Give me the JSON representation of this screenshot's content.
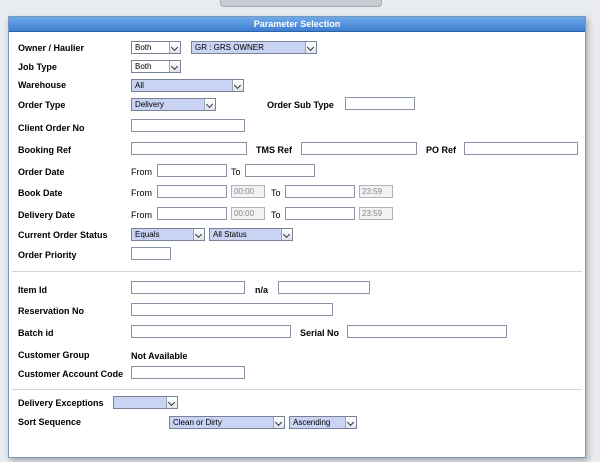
{
  "header": {
    "title": "Parameter Selection"
  },
  "owner_haulier": {
    "label": "Owner / Haulier",
    "scope": "Both",
    "owner": "GR : GRS OWNER"
  },
  "job_type": {
    "label": "Job Type",
    "value": "Both"
  },
  "warehouse": {
    "label": "Warehouse",
    "value": "All"
  },
  "order_type": {
    "label": "Order Type",
    "value": "Delivery",
    "sub_type_label": "Order Sub Type",
    "sub_type_value": ""
  },
  "client_order_no": {
    "label": "Client Order No",
    "value": ""
  },
  "booking_ref": {
    "label": "Booking Ref",
    "value": "",
    "tms_label": "TMS Ref",
    "tms_value": "",
    "po_label": "PO Ref",
    "po_value": ""
  },
  "order_date": {
    "label": "Order Date",
    "from_label": "From",
    "to_label": "To",
    "from_value": "",
    "to_value": ""
  },
  "book_date": {
    "label": "Book Date",
    "from_label": "From",
    "to_label": "To",
    "from_date": "",
    "from_time": "00:00",
    "to_date": "",
    "to_time": "23:59"
  },
  "delivery_date": {
    "label": "Delivery Date",
    "from_label": "From",
    "to_label": "To",
    "from_date": "",
    "from_time": "00:00",
    "to_date": "",
    "to_time": "23:59"
  },
  "current_order_status": {
    "label": "Current Order Status",
    "operator": "Equals",
    "status": "All Status"
  },
  "order_priority": {
    "label": "Order Priority",
    "value": ""
  },
  "item_id": {
    "label": "Item Id",
    "value": "",
    "na_label": "n/a",
    "na_value": ""
  },
  "reservation_no": {
    "label": "Reservation No",
    "value": ""
  },
  "batch_id": {
    "label": "Batch id",
    "value": "",
    "serial_label": "Serial No",
    "serial_value": ""
  },
  "customer_group": {
    "label": "Customer Group",
    "value": "Not Available"
  },
  "customer_account_code": {
    "label": "Customer Account Code",
    "value": ""
  },
  "delivery_exceptions": {
    "label": "Delivery Exceptions",
    "value": ""
  },
  "sort_sequence": {
    "label": "Sort Sequence",
    "field": "Clean or Dirty",
    "direction": "Ascending"
  },
  "colors": {
    "header_blue": "#3d7fd0",
    "input_border": "#8a93a5",
    "select_highlight": "#c9d3f3"
  }
}
